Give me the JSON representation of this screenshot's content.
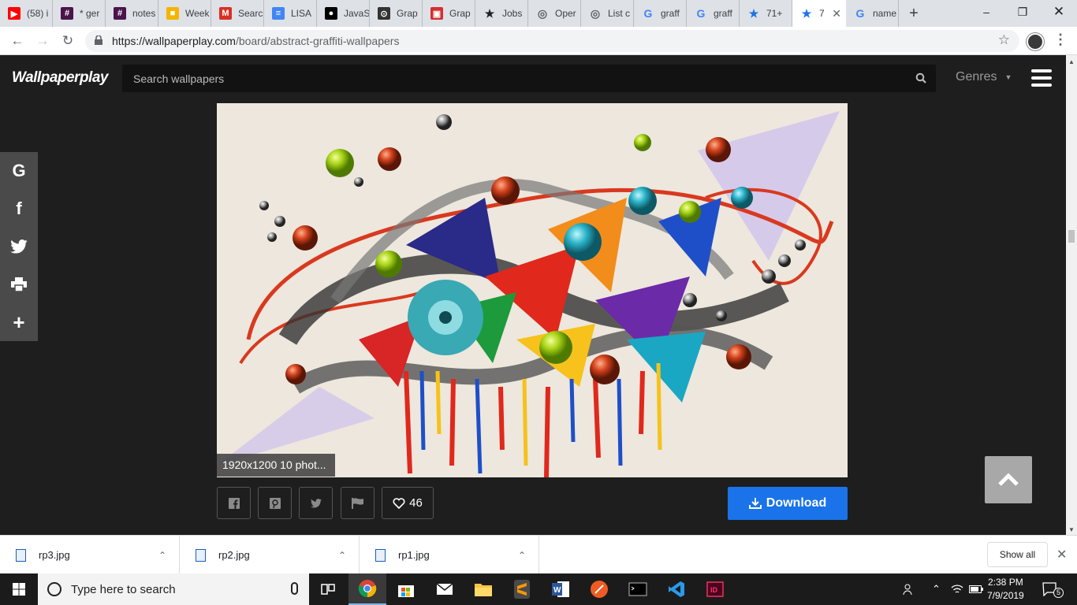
{
  "browser": {
    "tabs": [
      {
        "icon": "youtube-icon",
        "label": "(58) i",
        "color": "#ff0000"
      },
      {
        "icon": "slack-icon",
        "label": "* ger",
        "color": "#4a154b"
      },
      {
        "icon": "slack-icon",
        "label": "notes",
        "color": "#4a154b"
      },
      {
        "icon": "slides-icon",
        "label": "Week",
        "color": "#f4b400"
      },
      {
        "icon": "gmail-icon",
        "label": "Searc",
        "color": "#d93025"
      },
      {
        "icon": "docs-icon",
        "label": "LISA",
        "color": "#4285f4"
      },
      {
        "icon": "github-icon",
        "label": "JavaS",
        "color": "#000000"
      },
      {
        "icon": "graph-icon",
        "label": "Grap",
        "color": "#333333"
      },
      {
        "icon": "graph-red-icon",
        "label": "Grap",
        "color": "#d32f2f"
      },
      {
        "icon": "jobs-icon",
        "label": "Jobs",
        "color": "#202124"
      },
      {
        "icon": "globe-icon",
        "label": "Oper",
        "color": "#5f6368"
      },
      {
        "icon": "globe-icon",
        "label": "List c",
        "color": "#5f6368"
      },
      {
        "icon": "google-icon",
        "label": "graff",
        "color": "#4285f4"
      },
      {
        "icon": "google-icon",
        "label": "graff",
        "color": "#4285f4"
      },
      {
        "icon": "star-icon",
        "label": "71+",
        "color": "#1a73e8"
      },
      {
        "icon": "star-icon",
        "label": "7",
        "color": "#1a73e8",
        "active": true
      },
      {
        "icon": "google-icon",
        "label": "name",
        "color": "#4285f4"
      }
    ],
    "url_host": "https://wallpaperplay.com",
    "url_path": "/board/abstract-graffiti-wallpapers"
  },
  "site": {
    "logo": "Wallpaperplay",
    "search_placeholder": "Search wallpapers",
    "genres_label": "Genres",
    "caption": "1920x1200 10 phot...",
    "like_count": "46",
    "download_label": "Download",
    "share": [
      "google-icon",
      "facebook-icon",
      "twitter-icon",
      "print-icon",
      "plus-icon"
    ],
    "accent": "#1a73e8"
  },
  "downloads": {
    "items": [
      {
        "name": "rp3.jpg"
      },
      {
        "name": "rp2.jpg"
      },
      {
        "name": "rp1.jpg"
      }
    ],
    "show_all": "Show all"
  },
  "taskbar": {
    "search_placeholder": "Type here to search",
    "time": "2:38 PM",
    "date": "7/9/2019",
    "notifications": "5"
  }
}
